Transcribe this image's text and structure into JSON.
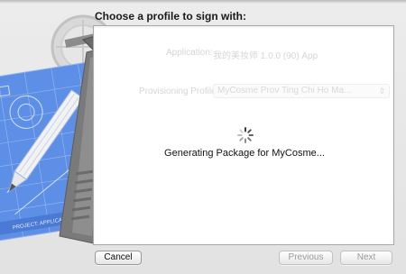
{
  "sheet": {
    "title": "Choose a profile to sign with:",
    "status": "Generating Package for MyCosme..."
  },
  "background_form": {
    "application_label": "Application:",
    "application_value": "我的美妆师 1.0.0 (90) App",
    "provisioning_label": "Provisioning Profile:",
    "provisioning_value": "MyCosme Prov Ting Chi Ho Ma..."
  },
  "illustration": {
    "blueprint_text": "PROJECT: APPLICATION"
  },
  "buttons": {
    "cancel": "Cancel",
    "previous": "Previous",
    "next": "Next"
  },
  "colors": {
    "blueprint": "#5d8fe6",
    "panel": "#ffffff",
    "disabled_text": "#9b9b9b"
  },
  "icons": [
    "loading-spinner-icon",
    "select-arrows-icon",
    "pencil-icon",
    "hammer-icon",
    "compass-icon"
  ]
}
